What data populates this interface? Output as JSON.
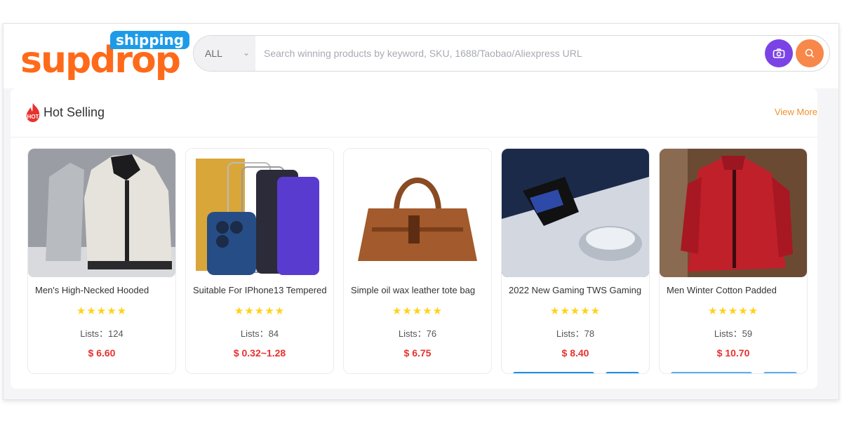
{
  "brand": {
    "logo_word": "supdrop",
    "logo_badge": "shipping",
    "primary_color": "#ff6a1a",
    "badge_color": "#1e9be8"
  },
  "search": {
    "category": "ALL",
    "placeholder": "Search winning products by keyword, SKU, 1688/Taobao/Aliexpress URL",
    "camera_icon": "camera-icon",
    "search_icon": "search-icon"
  },
  "section": {
    "title": "Hot Selling",
    "badge_text": "HOT",
    "view_more": "View More"
  },
  "products": [
    {
      "name": "Men's High-Necked Hooded",
      "stars": "★★★★★",
      "lists": "Lists：124",
      "price": "$ 6.60"
    },
    {
      "name": "Suitable For IPhone13 Tempered",
      "stars": "★★★★★",
      "lists": "Lists：84",
      "price": "$ 0.32~1.28"
    },
    {
      "name": "Simple oil wax leather tote bag",
      "stars": "★★★★★",
      "lists": "Lists：76",
      "price": "$ 6.75"
    },
    {
      "name": "2022 New Gaming TWS Gaming",
      "stars": "★★★★★",
      "lists": "Lists：78",
      "price": "$ 8.40"
    },
    {
      "name": "Men Winter Cotton Padded",
      "stars": "★★★★★",
      "lists": "Lists：59",
      "price": "$ 10.70"
    }
  ],
  "colors": {
    "price": "#e8312e",
    "star": "#ffd21a",
    "view_more": "#f0902e",
    "camera_btn": "#7b43e6",
    "search_btn": "#f7884a"
  }
}
